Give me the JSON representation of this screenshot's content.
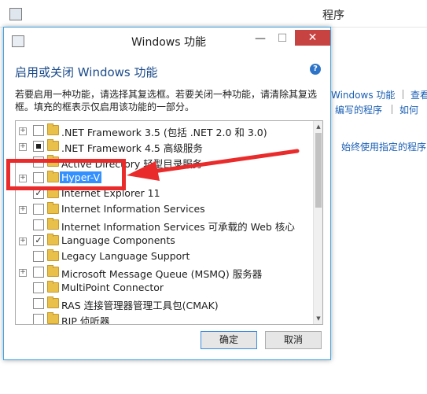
{
  "background_window": {
    "title": "程序",
    "links": [
      "Windows 功能",
      "查看",
      "编写的程序",
      "如何",
      "始终使用指定的程序"
    ]
  },
  "dialog": {
    "title": "Windows 功能",
    "min_glyph": "—",
    "max_glyph": "☐",
    "close_glyph": "✕",
    "heading": "启用或关闭 Windows 功能",
    "help_glyph": "?",
    "description": "若要启用一种功能，请选择其复选框。若要关闭一种功能，请清除其复选框。填充的框表示仅启用该功能的一部分。",
    "features": [
      {
        "label": ".NET Framework 3.5 (包括 .NET 2.0 和 3.0)",
        "expandable": true,
        "state": "unchecked"
      },
      {
        "label": ".NET Framework 4.5 高级服务",
        "expandable": true,
        "state": "partial"
      },
      {
        "label": "Active Directory 轻型目录服务",
        "expandable": false,
        "state": "unchecked"
      },
      {
        "label": "Hyper-V",
        "expandable": true,
        "state": "unchecked",
        "selected": true
      },
      {
        "label": "Internet Explorer 11",
        "expandable": false,
        "state": "checked"
      },
      {
        "label": "Internet Information Services",
        "expandable": true,
        "state": "unchecked"
      },
      {
        "label": "Internet Information Services 可承载的 Web 核心",
        "expandable": false,
        "state": "unchecked"
      },
      {
        "label": "Language Components",
        "expandable": true,
        "state": "checked"
      },
      {
        "label": "Legacy Language Support",
        "expandable": false,
        "state": "unchecked"
      },
      {
        "label": "Microsoft Message Queue (MSMQ) 服务器",
        "expandable": true,
        "state": "unchecked"
      },
      {
        "label": "MultiPoint Connector",
        "expandable": false,
        "state": "unchecked"
      },
      {
        "label": "RAS 连接管理器管理工具包(CMAK)",
        "expandable": false,
        "state": "unchecked"
      },
      {
        "label": "RIP 侦听器",
        "expandable": false,
        "state": "unchecked"
      }
    ],
    "ok_label": "确定",
    "cancel_label": "取消"
  },
  "annotation_color": "#ea2b2b",
  "accent_color": "#3390ff"
}
